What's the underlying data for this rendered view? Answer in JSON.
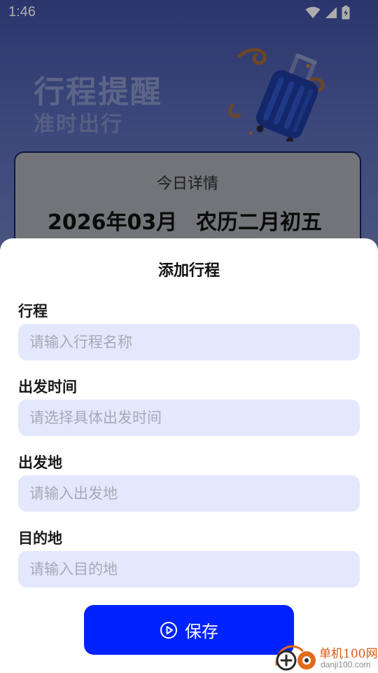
{
  "status_bar": {
    "time": "1:46",
    "icons": [
      "wifi-icon",
      "cellular-signal-icon",
      "battery-charging-icon"
    ]
  },
  "hero": {
    "title": "行程提醒",
    "subtitle": "准时出行"
  },
  "day_card": {
    "title": "今日详情",
    "month": "2026年03月",
    "lunar_date": "农历二月初五"
  },
  "sheet": {
    "title": "添加行程",
    "fields": [
      {
        "label": "行程",
        "placeholder": "请输入行程名称",
        "value": ""
      },
      {
        "label": "出发时间",
        "placeholder": "请选择具体出发时间",
        "value": ""
      },
      {
        "label": "出发地",
        "placeholder": "请输入出发地",
        "value": ""
      },
      {
        "label": "目的地",
        "placeholder": "请输入目的地",
        "value": ""
      }
    ],
    "save_label": "保存"
  },
  "watermark": {
    "name": "单机100网",
    "url": "danji100.com"
  },
  "colors": {
    "primary_button": "#0022ff",
    "input_background": "#e4e8fd",
    "header_background": "#4b5ba8",
    "watermark_brand": "#d95a10"
  }
}
